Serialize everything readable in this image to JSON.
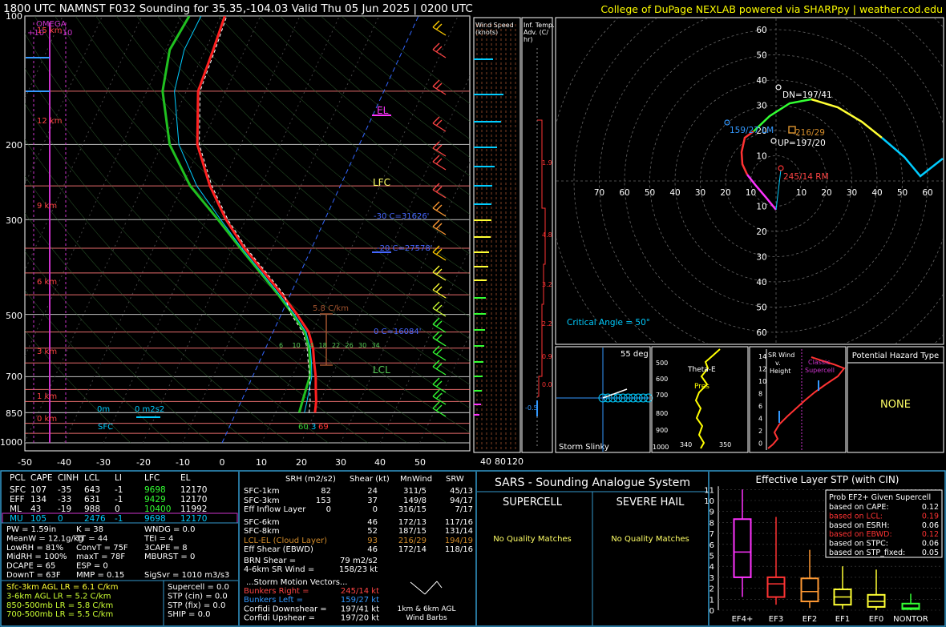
{
  "header": {
    "title": "1800 UTC NAMNST F032 Sounding for 35.35,-104.03 Valid  Thu 05 Jun 2025 | 0200 UTC",
    "credit": "College of DuPage NEXLAB powered via SHARPpy | weather.cod.edu"
  },
  "skewt": {
    "pressure_ticks": [
      "100",
      "200",
      "300",
      "500",
      "700",
      "850",
      "1000"
    ],
    "temp_ticks": [
      "-50",
      "-40",
      "-30",
      "-20",
      "-10",
      "0",
      "10",
      "20",
      "30",
      "40",
      "50"
    ],
    "height_labels": [
      "15 km",
      "12 km",
      "9 km",
      "6 km",
      "3 km",
      "1 km",
      "0 km"
    ],
    "omega_label": "OMEGA",
    "omega_left": "+10",
    "omega_right": "-10",
    "el_label": "EL",
    "lfc_label": "LFC",
    "lcl_label": "LCL",
    "m30_label": "-30 C=31626'",
    "m20_label": "-20 C=27578'",
    "zero_label": "0 C=16084'",
    "lapse_label": "5.8 C/km",
    "sfc_label": "SFC",
    "m0_label": "0m",
    "m2s2_label": "0 m2s2",
    "wetbulb_numbers": [
      "6",
      "10",
      "14",
      "18",
      "22",
      "26",
      "30",
      "34"
    ],
    "sfc_temp": "69",
    "sfc_dew": "60",
    "sfc_wb": "3"
  },
  "wind_speed_panel": {
    "title": "Wind Speed (knots)",
    "ticks": [
      "40",
      "80",
      "120"
    ]
  },
  "advection_panel": {
    "title": "Inf. Temp. Adv. (C/hr)",
    "values": [
      "1.9",
      "4.8",
      "3.2",
      "2.2",
      "0.9",
      "0.0",
      "-0.5"
    ]
  },
  "hodograph": {
    "rings": [
      "10",
      "20",
      "30",
      "40",
      "50",
      "60",
      "70"
    ],
    "dn": "DN=197/41",
    "lm": "159/27 LM",
    "up": "UP=197/20",
    "mean": "216/29",
    "rm": "245/14 RM",
    "critical": "Critical Angle = 50°"
  },
  "slinky": {
    "angle": "55 deg",
    "title": "Storm Slinky"
  },
  "theta_panel": {
    "labels": [
      "Theta-E",
      "Pres"
    ],
    "pres_ticks": [
      "500",
      "600",
      "700",
      "800",
      "900",
      "1000"
    ],
    "temp_ticks": [
      "340",
      "350"
    ]
  },
  "sr_wind": {
    "title": "SR Wind v. Height",
    "yticks": [
      "14",
      "12",
      "10",
      "8",
      "6",
      "4",
      "2",
      "0"
    ],
    "classic": "Classic Supercell"
  },
  "hazard": {
    "title": "Potential Hazard Type",
    "value": "NONE"
  },
  "parcel_table": {
    "headers": [
      "PCL",
      "CAPE",
      "CINH",
      "LCL",
      "LI",
      "LFC",
      "EL"
    ],
    "rows": [
      [
        "SFC",
        "107",
        "-35",
        "643",
        "-1",
        "9698",
        "12170"
      ],
      [
        "EFF",
        "134",
        "-33",
        "631",
        "-1",
        "9429",
        "12170"
      ],
      [
        "ML",
        "43",
        "-19",
        "988",
        "0",
        "10400",
        "11992"
      ],
      [
        "MU",
        "105",
        "0",
        "2476",
        "-1",
        "9698",
        "12170"
      ]
    ]
  },
  "indices": {
    "col1": [
      "PW = 1.59in",
      "MeanW = 12.1g/kg",
      "LowRH = 81%",
      "MidRH = 100%",
      "DCAPE = 65",
      "DownT = 63F"
    ],
    "col2": [
      "K = 38",
      "TT = 44",
      "ConvT = 75F",
      "maxT = 78F",
      "ESP = 0",
      "MMP = 0.15"
    ],
    "col3": [
      "WNDG = 0.0",
      "TEI = 4",
      "3CAPE = 8",
      "MBURST = 0",
      "",
      "SigSvr = 1010 m3/s3"
    ]
  },
  "lapse_rates": [
    "Sfc-3km AGL LR = 6.1 C/km",
    "3-6km AGL LR = 5.2 C/km",
    "850-500mb LR = 5.8 C/km",
    "700-500mb LR = 5.5 C/km"
  ],
  "composite": [
    "Supercell = 0.0",
    "STP (cin) = 0.0",
    "STP (fix) = 0.0",
    "SHIP = 0.0"
  ],
  "kinematic": {
    "headers": [
      "SRH (m2/s2)",
      "Shear (kt)",
      "MnWind",
      "SRW"
    ],
    "rows": [
      [
        "SFC-1km",
        "82",
        "24",
        "311/5",
        "45/13"
      ],
      [
        "SFC-3km",
        "153",
        "37",
        "149/8",
        "94/17"
      ],
      [
        "Eff Inflow Layer",
        "0",
        "0",
        "316/15",
        "7/17"
      ],
      [
        "SFC-6km",
        "",
        "46",
        "172/13",
        "117/16"
      ],
      [
        "SFC-8km",
        "",
        "52",
        "187/15",
        "131/14"
      ],
      [
        "LCL-EL (Cloud Layer)",
        "",
        "93",
        "216/29",
        "194/19"
      ],
      [
        "Eff Shear (EBWD)",
        "",
        "46",
        "172/14",
        "118/16"
      ]
    ],
    "brn_shear": "BRN Shear =",
    "brn_value": "79 m2/s2",
    "sr46": "4-6km SR Wind =",
    "sr46_value": "158/23 kt",
    "storm_motion_title": "...Storm Motion Vectors...",
    "vectors": [
      [
        "Bunkers Right =",
        "245/14 kt"
      ],
      [
        "Bunkers Left =",
        "159/27 kt"
      ],
      [
        "Corfidi Downshear =",
        "197/41 kt"
      ],
      [
        "Corfidi Upshear =",
        "197/20 kt"
      ]
    ],
    "barbs_label": "1km & 6km AGL Wind Barbs"
  },
  "sars": {
    "title": "SARS - Sounding Analogue System",
    "supercell": "SUPERCELL",
    "hail": "SEVERE HAIL",
    "supercell_result": "No Quality Matches",
    "hail_result": "No Quality Matches"
  },
  "stp_box": {
    "title": "Effective Layer STP (with CIN)",
    "legend_title": "Prob EF2+ Given Supercell",
    "legend": [
      [
        "based on CAPE:",
        "0.12"
      ],
      [
        "based on LCL:",
        "0.19"
      ],
      [
        "based on ESRH:",
        "0.06"
      ],
      [
        "based on EBWD:",
        "0.12"
      ],
      [
        "based on STPC:",
        "0.06"
      ],
      [
        "based on STP_fixed:",
        "0.05"
      ]
    ],
    "yticks": [
      "0",
      "1",
      "2",
      "3",
      "4",
      "5",
      "6",
      "7",
      "8",
      "9",
      "10",
      "11"
    ],
    "categories": [
      "EF4+",
      "EF3",
      "EF2",
      "EF1",
      "EF0",
      "NONTOR"
    ]
  },
  "chart_data": [
    {
      "type": "line",
      "title": "1800 UTC NAMNST F032 Sounding for 35.35,-104.03 Valid  Thu 05 Jun 2025 | 0200 UTC",
      "xlim": [
        -50,
        50
      ],
      "ylim": [
        1000,
        100
      ],
      "series": [
        {
          "name": "Temperature",
          "color": "#ff2020",
          "x": [
            20,
            19,
            17.5,
            16,
            14,
            12,
            9,
            4,
            -2,
            -9,
            -17,
            -25,
            -33,
            -41,
            -47,
            -48,
            -49
          ],
          "y": [
            850,
            800,
            750,
            700,
            650,
            600,
            550,
            500,
            450,
            400,
            350,
            300,
            250,
            200,
            150,
            120,
            100
          ]
        },
        {
          "name": "Dewpoint",
          "color": "#20c020",
          "x": [
            16,
            15.5,
            15,
            14.5,
            13,
            11,
            8,
            3,
            -3,
            -10,
            -18,
            -27,
            -38,
            -48,
            -56,
            -59,
            -58
          ],
          "y": [
            850,
            800,
            750,
            700,
            650,
            600,
            550,
            500,
            450,
            400,
            350,
            300,
            250,
            200,
            150,
            120,
            100
          ]
        }
      ]
    },
    {
      "type": "scatter",
      "title": "Effective Layer STP (with CIN)",
      "categories": [
        "EF4+",
        "EF3",
        "EF2",
        "EF1",
        "EF0",
        "NONTOR"
      ],
      "series": [
        {
          "name": "p10",
          "values": [
            1.2,
            0.5,
            0.2,
            0.1,
            0.0,
            0.0
          ]
        },
        {
          "name": "p25",
          "values": [
            3.0,
            1.2,
            0.8,
            0.5,
            0.3,
            0.1
          ]
        },
        {
          "name": "median",
          "values": [
            5.3,
            2.4,
            1.7,
            1.2,
            0.8,
            0.2
          ]
        },
        {
          "name": "p75",
          "values": [
            8.3,
            3.0,
            2.9,
            1.9,
            1.4,
            0.6
          ]
        },
        {
          "name": "p90",
          "values": [
            11.0,
            8.5,
            5.5,
            4.0,
            3.7,
            1.5
          ]
        }
      ],
      "ylim": [
        0,
        11
      ]
    }
  ]
}
